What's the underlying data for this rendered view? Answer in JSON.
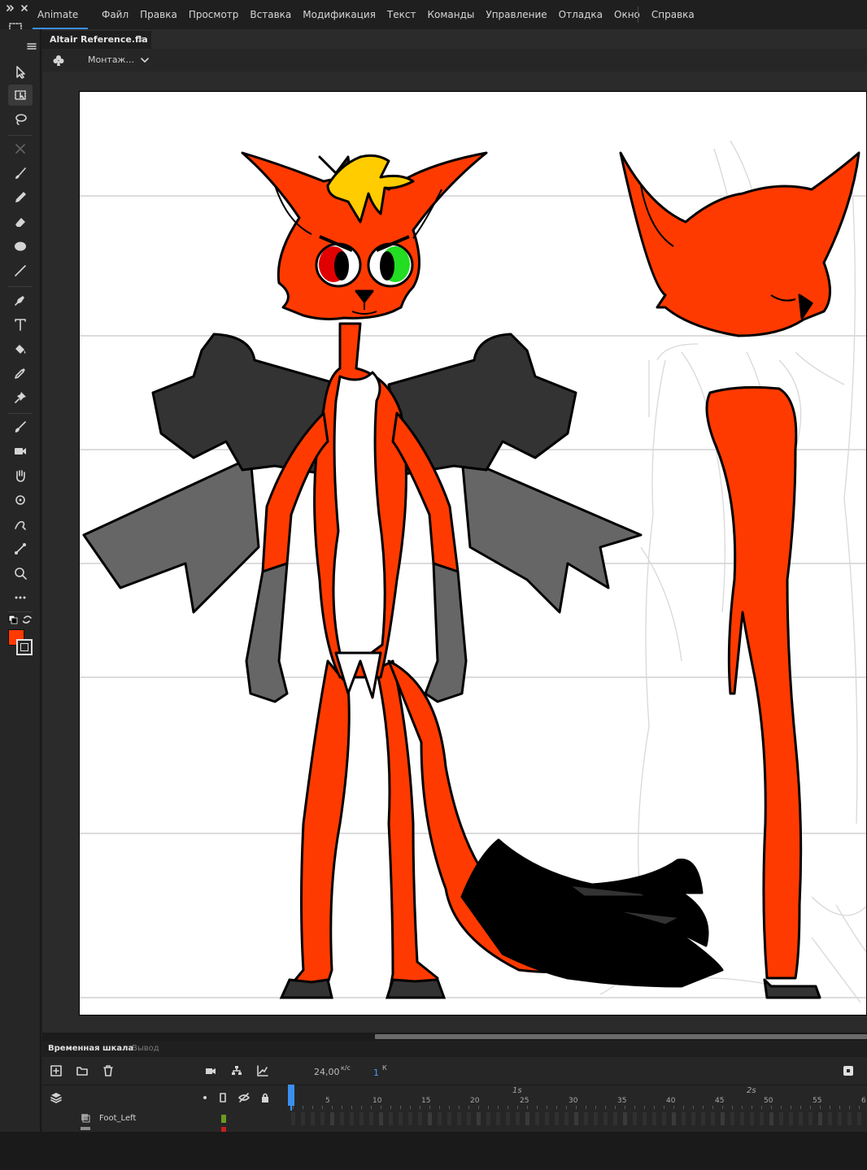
{
  "app": {
    "name": "Animate"
  },
  "menu": [
    "Файл",
    "Правка",
    "Просмотр",
    "Вставка",
    "Модификация",
    "Текст",
    "Команды",
    "Управление",
    "Отладка",
    "Окно",
    "Справка"
  ],
  "document": {
    "tab_title": "Altair Reference.fla",
    "close_glyph": "×"
  },
  "editbar": {
    "scene_label": "Монтаж..."
  },
  "toolbar": {
    "tools": [
      "selection-icon",
      "free-transform-icon",
      "lasso-icon",
      "rotate-3d-icon",
      "brush-icon",
      "pencil-icon",
      "eraser-icon",
      "oval-icon",
      "line-icon",
      "pen-icon",
      "text-icon",
      "paint-bucket-icon",
      "eyedropper-icon",
      "pin-icon",
      "fluid-brush-icon",
      "camera-icon",
      "hand-icon",
      "rotation-icon",
      "puppet-icon",
      "bone-icon",
      "zoom-icon",
      "more-icon"
    ],
    "fill_color": "#ff3a00",
    "stroke_color": "#000000"
  },
  "timeline": {
    "tab_active": "Временная шкала",
    "tab_inactive": "Вывод",
    "fps": "24,00",
    "fps_unit": "к/с",
    "current_frame": "1",
    "frame_unit": "К",
    "seconds": [
      "1s",
      "2s"
    ],
    "ruler_numbers": [
      "5",
      "10",
      "15",
      "20",
      "25",
      "30",
      "35",
      "40",
      "45",
      "50",
      "55",
      "6"
    ],
    "layers": [
      {
        "name": "Foot_Left",
        "color": "#6b9a1e"
      }
    ]
  },
  "colors": {
    "fox_orange": "#ff3a00",
    "wing_dark": "#333333",
    "wing_light": "#666666",
    "hair_yellow": "#ffcc00",
    "eye_red": "#e00000",
    "eye_green": "#22dd22",
    "accent_blue": "#3b8ff0"
  }
}
